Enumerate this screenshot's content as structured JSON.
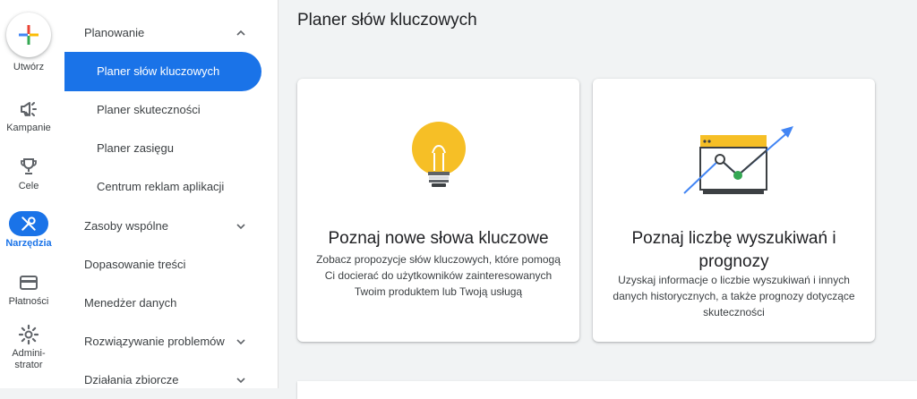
{
  "rail": {
    "create_label": "Utwórz",
    "items": [
      {
        "label": "Kampanie",
        "icon": "megaphone-icon"
      },
      {
        "label": "Cele",
        "icon": "trophy-icon"
      },
      {
        "label": "Narzędzia",
        "icon": "tools-icon",
        "active": true
      },
      {
        "label": "Płatności",
        "icon": "credit-card-icon"
      },
      {
        "label": "Admini-\nstrator",
        "icon": "gear-icon"
      }
    ],
    "active_color": "#1a73e8"
  },
  "nav": {
    "section_title": "Planowanie",
    "sub_items": [
      "Planer słów kluczowych",
      "Planer skuteczności",
      "Planer zasięgu",
      "Centrum reklam aplikacji"
    ],
    "sections": [
      "Zasoby wspólne",
      "Dopasowanie treści",
      "Menedżer danych",
      "Rozwiązywanie problemów",
      "Działania zbiorcze"
    ]
  },
  "main": {
    "title": "Planer słów kluczowych",
    "cards": [
      {
        "title": "Poznaj nowe słowa kluczowe",
        "description": "Zobacz propozycje słów kluczowych, które pomogą Ci docierać do użytkowników zainteresowanych Twoim produktem lub Twoją usługą",
        "icon": "lightbulb-icon"
      },
      {
        "title": "Poznaj liczbę wyszukiwań i prognozy",
        "description": "Uzyskaj informacje o liczbie wyszukiwań i innych danych historycznych, a także prognozy dotyczące skuteczności",
        "icon": "chart-trend-icon"
      }
    ]
  }
}
